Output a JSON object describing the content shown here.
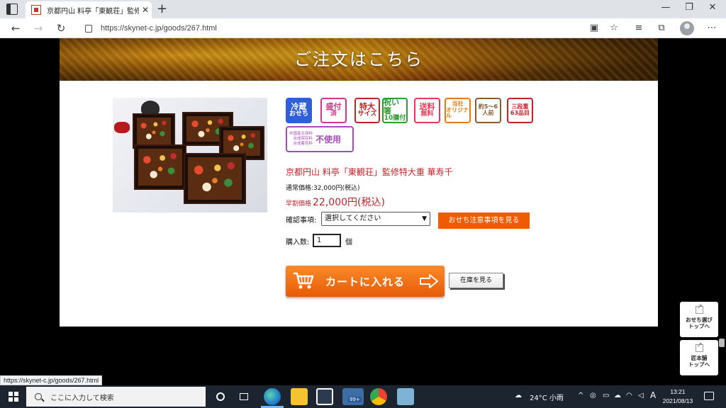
{
  "browser": {
    "tab_title": "京都円山 料亭「東観荘」監修特大",
    "tab_close": "✕",
    "new_tab": "+",
    "url": "https://skynet-c.jp/goods/267.html",
    "status_url": "https://skynet-c.jp/goods/267.html",
    "window_controls": {
      "minimize": "—",
      "restore": "❐",
      "close": "✕"
    }
  },
  "page": {
    "banner_heading": "ご注文はこちら",
    "badges": [
      {
        "l1": "冷蔵",
        "l2": "おせち",
        "style": "filled",
        "color": "#2f5fd6"
      },
      {
        "l1": "盛付",
        "l2": "済",
        "style": "outline",
        "color": "#d6338a"
      },
      {
        "l1": "特大",
        "l2": "サイズ",
        "style": "outline",
        "color": "#c0222a"
      },
      {
        "l1": "祝い箸",
        "l2": "10膳付",
        "style": "outline",
        "color": "#2e9b2e"
      },
      {
        "l1": "送料",
        "l2": "無料",
        "style": "outline",
        "color": "#e8385a"
      },
      {
        "l1": "当社",
        "l2": "オリジナル",
        "style": "outline",
        "color": "#e87912"
      },
      {
        "l1": "約5〜6",
        "l2": "人前",
        "style": "outline",
        "color": "#8b5a2b"
      },
      {
        "l1": "三段重",
        "l2": "63品目",
        "style": "outline",
        "color": "#c0222a"
      }
    ],
    "badge_additive": {
      "lines": [
        "中国産主原料",
        "合成保存料",
        "合成着色料"
      ],
      "big": "不使用",
      "color": "#a64cb8"
    },
    "product_name": "京都円山 料亭「東観荘」監修特大重 華寿千",
    "regular_price": "通常価格:32,000円(税込)",
    "early_label": "早割価格",
    "early_price": "22,000円(税込)",
    "confirm_label": "確認事項:",
    "confirm_select": "選択してください",
    "notice_button": "おせち注意事項を見る",
    "qty_label": "購入数:",
    "qty_value": "1",
    "qty_unit": "個",
    "cart_button": "カートに入れる",
    "stock_button": "在庫を見る",
    "floatnav": [
      {
        "line1": "おせち選び",
        "line2": "トップへ"
      },
      {
        "line1": "匠本舗",
        "line2": "トップへ"
      }
    ]
  },
  "taskbar": {
    "search_placeholder": "ここに入力して検索",
    "badge_count": "99+",
    "weather": "24°C 小雨",
    "ime": "A",
    "time": "13:21",
    "date": "2021/08/13"
  }
}
